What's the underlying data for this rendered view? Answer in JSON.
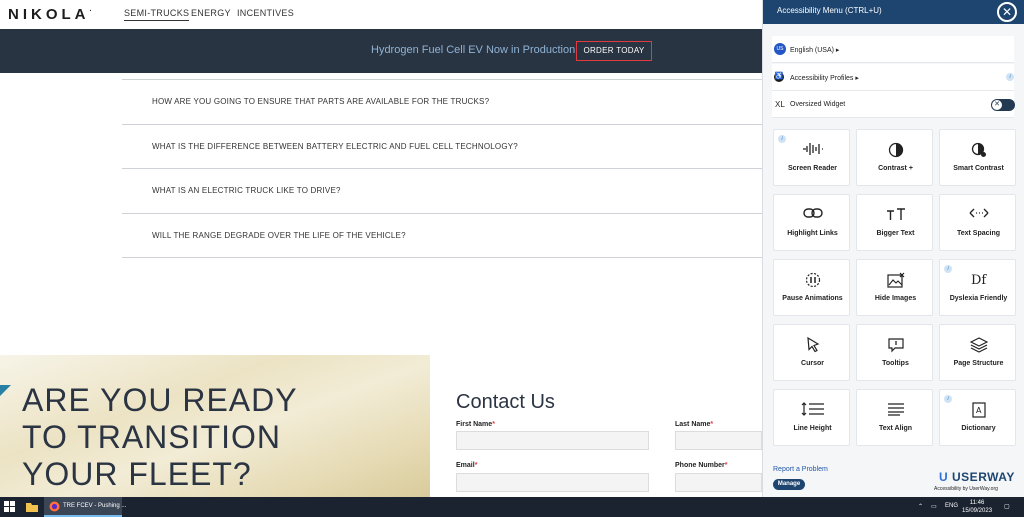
{
  "nav": {
    "logo": "NIKOLA",
    "items": [
      "SEMI-TRUCKS",
      "ENERGY",
      "INCENTIVES"
    ]
  },
  "announcement": {
    "text": "Hydrogen Fuel Cell EV Now in Production",
    "button": "ORDER TODAY"
  },
  "faq": [
    "HOW ARE YOU GOING TO ENSURE THAT PARTS ARE AVAILABLE FOR THE TRUCKS?",
    "WHAT IS THE DIFFERENCE BETWEEN BATTERY ELECTRIC AND FUEL CELL TECHNOLOGY?",
    "WHAT IS AN ELECTRIC TRUCK LIKE TO DRIVE?",
    "WILL THE RANGE DEGRADE OVER THE LIFE OF THE VEHICLE?"
  ],
  "hero": {
    "lines": [
      "ARE YOU READY",
      "TO TRANSITION",
      "YOUR FLEET?"
    ]
  },
  "contact": {
    "title": "Contact Us",
    "first_name": "First Name",
    "last_name": "Last Name",
    "email": "Email",
    "phone": "Phone Number",
    "required_mark": "*"
  },
  "accessibility": {
    "title": "Accessibility Menu (CTRL+U)",
    "close": "✕",
    "language_flag": "US",
    "language": "English (USA)",
    "profiles": "Accessibility Profiles",
    "oversized_prefix": "XL",
    "oversized": "Oversized Widget",
    "toggle_off": "✕",
    "tiles": [
      {
        "label": "Screen Reader",
        "icon": "waveform-icon",
        "info": true
      },
      {
        "label": "Contrast +",
        "icon": "contrast-icon",
        "info": false
      },
      {
        "label": "Smart Contrast",
        "icon": "smart-contrast-icon",
        "info": false
      },
      {
        "label": "Highlight Links",
        "icon": "link-icon",
        "info": false
      },
      {
        "label": "Bigger Text",
        "icon": "text-size-icon",
        "info": false
      },
      {
        "label": "Text Spacing",
        "icon": "text-spacing-icon",
        "info": false
      },
      {
        "label": "Pause Animations",
        "icon": "pause-icon",
        "info": false
      },
      {
        "label": "Hide Images",
        "icon": "hide-image-icon",
        "info": false
      },
      {
        "label": "Dyslexia Friendly",
        "icon": "dyslexia-icon",
        "info": true
      },
      {
        "label": "Cursor",
        "icon": "cursor-icon",
        "info": false
      },
      {
        "label": "Tooltips",
        "icon": "tooltip-icon",
        "info": false
      },
      {
        "label": "Page Structure",
        "icon": "layers-icon",
        "info": false
      },
      {
        "label": "Line Height",
        "icon": "line-height-icon",
        "info": false
      },
      {
        "label": "Text Align",
        "icon": "align-icon",
        "info": false
      },
      {
        "label": "Dictionary",
        "icon": "dictionary-icon",
        "info": true
      }
    ],
    "report": "Report a Problem",
    "manage": "Manage",
    "brand": "USERWAY",
    "brand_tag": "Accessibility by UserWay.org"
  },
  "taskbar": {
    "app": "TRE FCEV - Pushing ...",
    "lang": "ENG",
    "time": "11:46",
    "date": "15/09/2023"
  },
  "colors": {
    "announce_bg": "#283442",
    "panel_header": "#1d4570",
    "accent_red": "#e03a3e"
  }
}
